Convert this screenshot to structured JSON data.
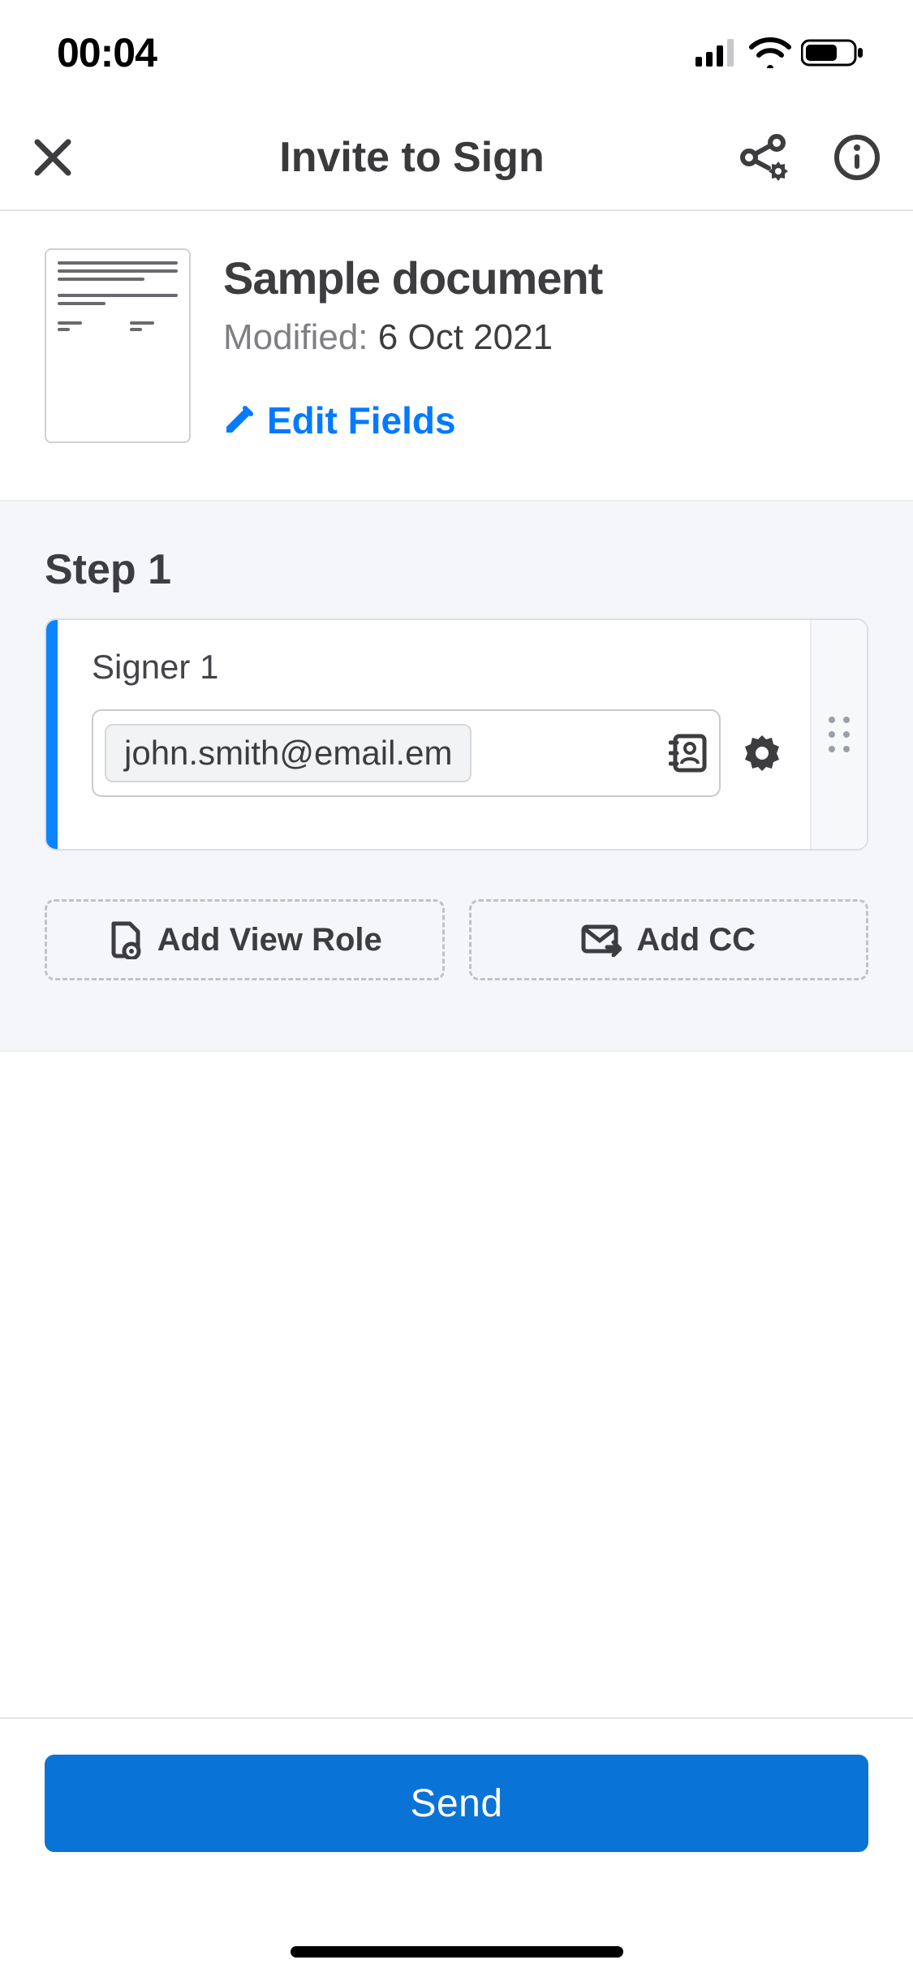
{
  "statusbar": {
    "time": "00:04"
  },
  "header": {
    "title": "Invite to Sign"
  },
  "document": {
    "title": "Sample document",
    "modified_label": "Modified:",
    "modified_date": "6 Oct 2021",
    "edit_fields_label": "Edit Fields"
  },
  "steps": [
    {
      "title": "Step 1",
      "signer_label": "Signer 1",
      "email": "john.smith@email.em"
    }
  ],
  "actions": {
    "add_view_role": "Add View Role",
    "add_cc": "Add CC"
  },
  "footer": {
    "send": "Send"
  }
}
